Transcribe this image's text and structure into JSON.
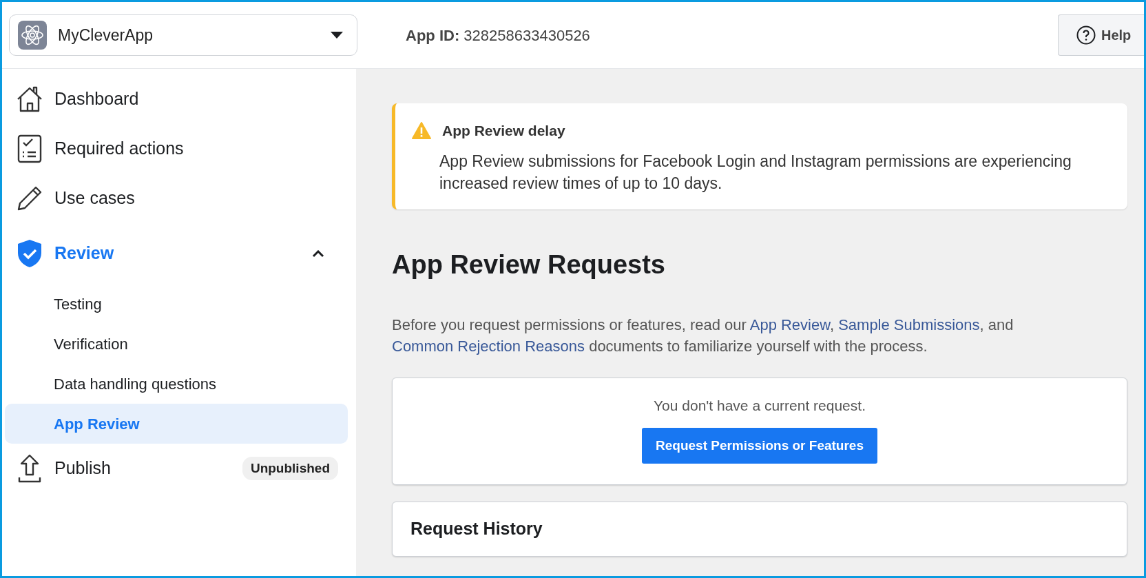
{
  "app_selector": {
    "name": "MyCleverApp"
  },
  "app_id": {
    "label": "App ID:",
    "value": "328258633430526"
  },
  "help_button": {
    "label": "Help"
  },
  "sidebar": {
    "items": [
      {
        "kind": "item",
        "label": "Dashboard",
        "selected": false
      },
      {
        "kind": "item",
        "label": "Required actions",
        "selected": false
      },
      {
        "kind": "item",
        "label": "Use cases",
        "selected": false
      },
      {
        "kind": "section",
        "label": "Review",
        "selected": true,
        "expanded": true,
        "children": [
          {
            "label": "Testing",
            "selected": false
          },
          {
            "label": "Verification",
            "selected": false
          },
          {
            "label": "Data handling questions",
            "selected": false
          },
          {
            "label": "App Review",
            "selected": true
          }
        ]
      },
      {
        "kind": "item",
        "label": "Publish",
        "selected": false,
        "badge": "Unpublished"
      }
    ]
  },
  "alert": {
    "title": "App Review delay",
    "text": "App Review submissions for Facebook Login and Instagram permissions are experiencing increased review times of up to 10 days."
  },
  "heading": "App Review Requests",
  "intro": [
    {
      "kind": "text",
      "text": "Before you request permissions or features, read our "
    },
    {
      "kind": "link",
      "text": "App Review"
    },
    {
      "kind": "text",
      "text": ", "
    },
    {
      "kind": "link",
      "text": "Sample Submissions"
    },
    {
      "kind": "text",
      "text": ", and "
    },
    {
      "kind": "link",
      "text": "Common Rejection Reasons"
    },
    {
      "kind": "text",
      "text": " documents to familiarize yourself with the process."
    }
  ],
  "current_request": {
    "message": "You don't have a current request.",
    "button": "Request Permissions or Features"
  },
  "history": {
    "title": "Request History"
  }
}
